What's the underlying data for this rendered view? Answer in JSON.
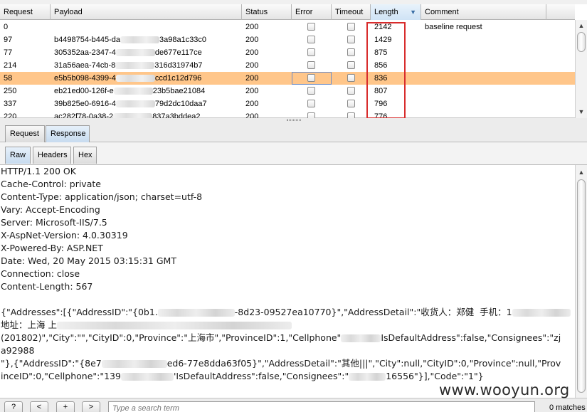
{
  "table": {
    "columns": [
      "Request",
      "Payload",
      "Status",
      "Error",
      "Timeout",
      "Length",
      "Comment"
    ],
    "sorted_column": "Length",
    "rows": [
      {
        "request": "0",
        "payload_a": "",
        "payload_b": "",
        "status": "200",
        "length": "2142",
        "comment": "baseline request",
        "selected": false
      },
      {
        "request": "97",
        "payload_a": "b4498754-b445-da",
        "payload_b": "3a98a1c33c0",
        "status": "200",
        "length": "1429",
        "comment": "",
        "selected": false
      },
      {
        "request": "77",
        "payload_a": "305352aa-2347-4",
        "payload_b": "de677e117ce",
        "status": "200",
        "length": "875",
        "comment": "",
        "selected": false
      },
      {
        "request": "214",
        "payload_a": "31a56aea-74cb-8",
        "payload_b": "316d31974b7",
        "status": "200",
        "length": "856",
        "comment": "",
        "selected": false
      },
      {
        "request": "58",
        "payload_a": "e5b5b098-4399-4",
        "payload_b": "ccd1c12d796",
        "status": "200",
        "length": "836",
        "comment": "",
        "selected": true
      },
      {
        "request": "250",
        "payload_a": "eb21ed00-126f-e",
        "payload_b": "23b5bae21084",
        "status": "200",
        "length": "807",
        "comment": "",
        "selected": false
      },
      {
        "request": "337",
        "payload_a": "39b825e0-6916-4",
        "payload_b": "79d2dc10daa7",
        "status": "200",
        "length": "796",
        "comment": "",
        "selected": false
      },
      {
        "request": "220",
        "payload_a": "ac282f78-0a38-2",
        "payload_b": "837a3bddea2",
        "status": "200",
        "length": "776",
        "comment": "",
        "selected": false
      }
    ],
    "highlight_color": "#d82c2c",
    "selected_row_color": "#ffc68a"
  },
  "tabs": {
    "request": "Request",
    "response": "Response",
    "raw": "Raw",
    "headers": "Headers",
    "hex": "Hex",
    "active_main": "Response",
    "active_view": "Raw"
  },
  "response": {
    "headers": [
      "HTTP/1.1 200 OK",
      "Cache-Control: private",
      "Content-Type: application/json; charset=utf-8",
      "Vary: Accept-Encoding",
      "Server: Microsoft-IIS/7.5",
      "X-AspNet-Version: 4.0.30319",
      "X-Powered-By: ASP.NET",
      "Date: Wed, 20 May 2015 03:15:31 GMT",
      "Connection: close",
      "Content-Length: 567"
    ],
    "body": {
      "l1a": "{\"Addresses\":[{\"AddressID\":\"{0b1.",
      "l1b": "-8d23-09527ea10770}\",\"AddressDetail\":\"收货人：郑健  手机：1",
      "l2a": "地址：上海 上",
      "l3a": "(201802)\",\"City\":\"\",\"CityID\":0,\"Province\":\"上海市\",\"ProvinceID\":1,\"Cellphone\"",
      "l3b": "IsDefaultAddress\":false,\"Consignees\":\"zj",
      "l4": "a92988",
      "l5a": "\"},{\"AddressID\":\"{8e7",
      "l5b": "ed6-77e8dda63f05}\",\"AddressDetail\":\"其他|||\",\"City\":null,\"CityID\":0,\"Province\":null,\"Prov",
      "l6a": "inceID\":0,\"Cellphone\":\"139",
      "l6b": "'IsDefaultAddress\":false,\"Consignees\":\"",
      "l6c": "16556\"}],\"Code\":\"1\"}"
    }
  },
  "search": {
    "help_label": "?",
    "prev_label": "<",
    "add_label": "+",
    "next_label": ">",
    "placeholder": "Type a search term",
    "matches": "0 matches"
  },
  "watermark": "www.wooyun.org"
}
